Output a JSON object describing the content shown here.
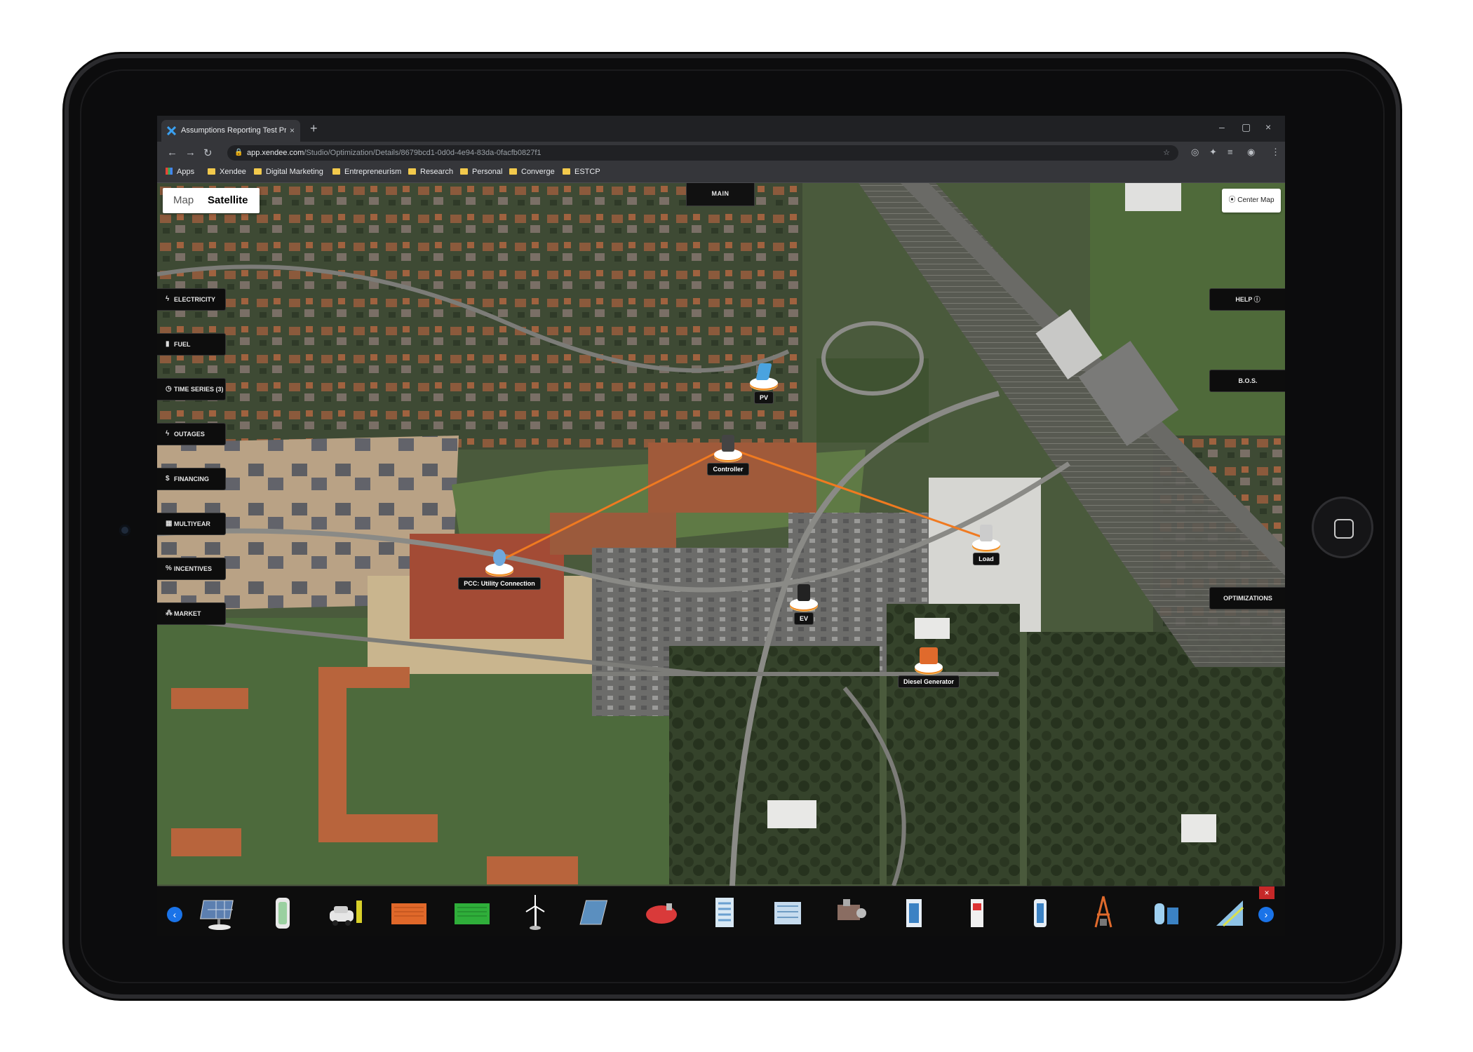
{
  "browser": {
    "tab_title": "Assumptions Reporting Test Proj",
    "tab_close": "×",
    "new_tab": "+",
    "window_controls": [
      "–",
      "▢",
      "×"
    ],
    "url_host": "app.xendee.com",
    "url_path": "/Studio/Optimization/Details/8679bcd1-0d0d-4e94-83da-0facfb0827f1",
    "bookmarks": [
      "Apps",
      "Xendee",
      "Digital Marketing",
      "Entrepreneurism",
      "Research",
      "Personal",
      "Converge",
      "ESTCP"
    ]
  },
  "map": {
    "map_type": {
      "map_label": "Map",
      "satellite_label": "Satellite",
      "selected": "Satellite"
    },
    "center_map_label": "Center Map",
    "main_label": "MAIN",
    "left_menu": [
      {
        "label": "ELECTRICITY",
        "icon": "bolt-icon"
      },
      {
        "label": "FUEL",
        "icon": "fuel-icon"
      },
      {
        "label": "TIME SERIES (3)",
        "icon": "clock-icon"
      },
      {
        "label": "OUTAGES",
        "icon": "bolt-icon"
      },
      {
        "label": "FINANCING",
        "icon": "dollar-icon"
      },
      {
        "label": "MULTIYEAR",
        "icon": "calendar-icon"
      },
      {
        "label": "INCENTIVES",
        "icon": "percent-icon"
      },
      {
        "label": "MARKET",
        "icon": "market-icon"
      }
    ],
    "right_menu": [
      "HELP ⓘ",
      "B.O.S.",
      "OPTIMIZATIONS"
    ],
    "nodes": [
      {
        "label": "PV",
        "color": "#4aa3df"
      },
      {
        "label": "Controller",
        "color": "#444444"
      },
      {
        "label": "PCC: Utility Connection",
        "color": "#6fa8dc"
      },
      {
        "label": "Load",
        "color": "#cccccc"
      },
      {
        "label": "EV",
        "color": "#222222"
      },
      {
        "label": "Diesel Generator",
        "color": "#e06a2c"
      }
    ],
    "link_color": "#f07a20"
  },
  "toolbar": {
    "prev": "‹",
    "next": "›",
    "close": "×",
    "tools": [
      "solar-panel-icon",
      "battery-icon",
      "ev-charger-icon",
      "diesel-generator-icon",
      "gas-generator-icon",
      "wind-turbine-icon",
      "solar-thermal-icon",
      "boiler-icon",
      "building-icon",
      "chiller-icon",
      "chp-engine-icon",
      "fuel-cell-icon",
      "heat-pump-icon",
      "electrolyzer-icon",
      "transformer-icon",
      "hydrogen-tank-icon",
      "substation-icon"
    ]
  }
}
